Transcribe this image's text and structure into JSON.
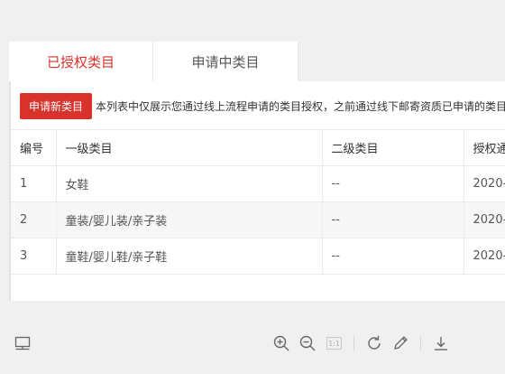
{
  "tabs": [
    {
      "label": "已授权类目",
      "active": true
    },
    {
      "label": "申请中类目",
      "active": false
    }
  ],
  "toolbar": {
    "apply_label": "申请新类目",
    "notice": "本列表中仅展示您通过线上流程申请的类目授权，之前通过线下邮寄资质已申请的类目"
  },
  "table": {
    "headers": [
      "编号",
      "一级类目",
      "二级类目",
      "授权通"
    ],
    "rows": [
      [
        "1",
        "女鞋",
        "--",
        "2020-"
      ],
      [
        "2",
        "童装/婴儿装/亲子装",
        "--",
        "2020-"
      ],
      [
        "3",
        "童鞋/婴儿鞋/亲子鞋",
        "--",
        "2020-"
      ]
    ]
  },
  "viewer": {
    "page_indicator": "1:1",
    "icons": [
      "sidebar-toggle-icon",
      "zoom-in-icon",
      "zoom-out-icon",
      "actual-size-icon",
      "rotate-icon",
      "pen-icon",
      "download-icon"
    ]
  },
  "colors": {
    "accent": "#d8322c",
    "background": "#f0f0f0"
  }
}
